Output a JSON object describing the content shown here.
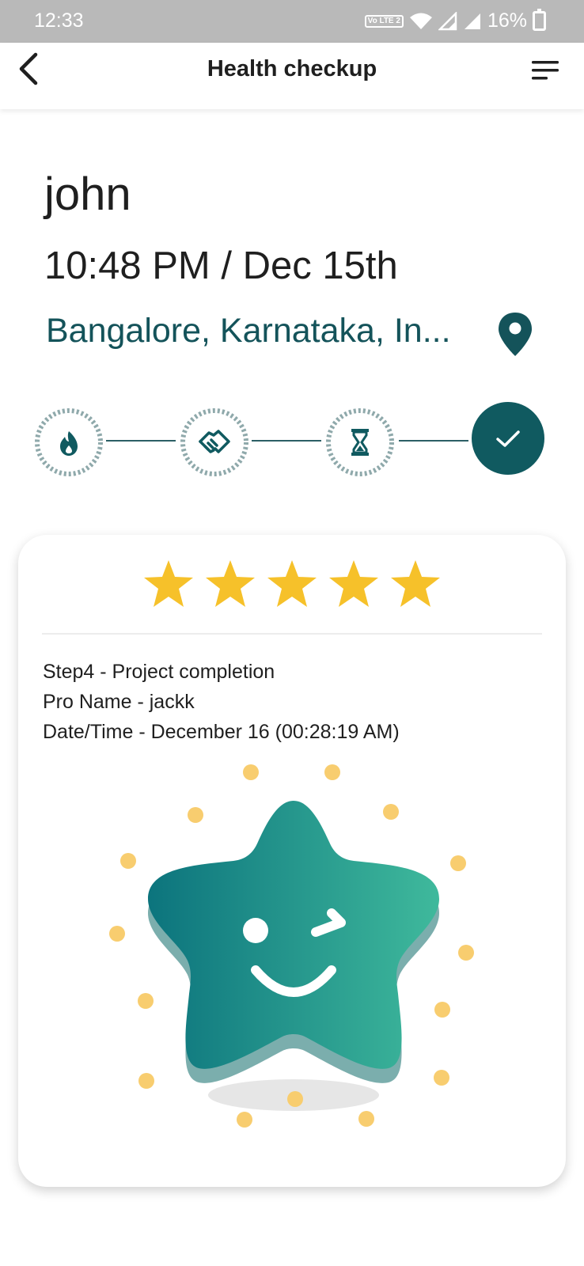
{
  "status_bar": {
    "time": "12:33",
    "network_badge": "Vo LTE 2",
    "battery": "16%"
  },
  "app_bar": {
    "title": "Health checkup",
    "back_icon": "chevron-left-icon",
    "menu_icon": "menu-icon"
  },
  "booking": {
    "name": "john",
    "datetime": "10:48 PM / Dec 15th",
    "location": "Bangalore, Karnataka, In...",
    "location_icon": "map-pin-icon"
  },
  "progress": {
    "steps": [
      {
        "icon": "flame-icon",
        "state": "done"
      },
      {
        "icon": "handshake-icon",
        "state": "done"
      },
      {
        "icon": "hourglass-icon",
        "state": "done"
      },
      {
        "icon": "check-icon",
        "state": "current"
      }
    ],
    "accent": "#105a60"
  },
  "card": {
    "rating": 5,
    "rating_max": 5,
    "star_color": "#f6c12a",
    "step_line": "Step4  - Project completion",
    "pro_line": "Pro Name  - jackk",
    "datetime_line": "Date/Time  - December 16  (00:28:19 AM)",
    "illustration": "winking-star-mascot",
    "mascot_colors": [
      "#0c747d",
      "#3fb99c"
    ]
  }
}
